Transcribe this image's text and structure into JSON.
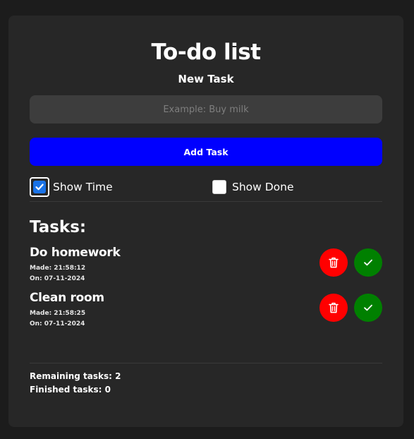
{
  "header": {
    "title": "To-do list",
    "subtitle": "New Task"
  },
  "form": {
    "input_value": "",
    "input_placeholder": "Example: Buy milk",
    "add_button_label": "Add Task"
  },
  "options": {
    "show_time": {
      "label": "Show Time",
      "checked": true
    },
    "show_done": {
      "label": "Show Done",
      "checked": false
    }
  },
  "tasks": {
    "heading": "Tasks:",
    "items": [
      {
        "name": "Do homework",
        "made": "Made: 21:58:12",
        "on": "On: 07-11-2024",
        "delete_icon": "trash-icon",
        "complete_icon": "check-icon"
      },
      {
        "name": "Clean room",
        "made": "Made: 21:58:25",
        "on": "On: 07-11-2024",
        "delete_icon": "trash-icon",
        "complete_icon": "check-icon"
      }
    ]
  },
  "stats": {
    "remaining": "Remaining tasks: 2",
    "finished": "Finished tasks: 0"
  },
  "colors": {
    "background": "#1c1c1c",
    "card": "#272727",
    "input": "#3d3d3d",
    "primary": "#0000ff",
    "delete": "#ff0000",
    "complete": "#008000",
    "checkbox": "#1a73e8"
  }
}
